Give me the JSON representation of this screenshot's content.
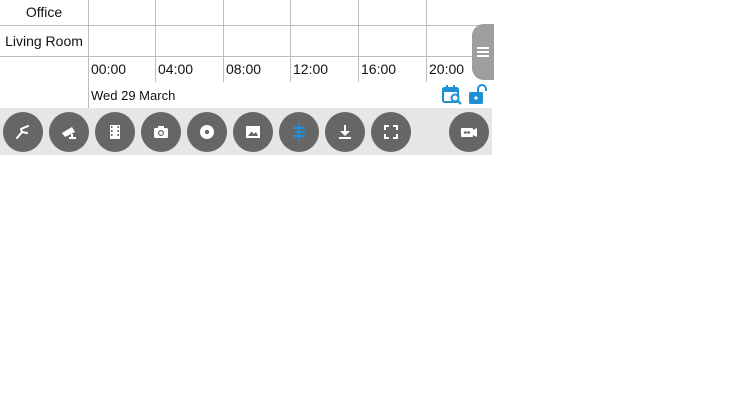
{
  "timeline": {
    "rows": [
      {
        "label": "Office"
      },
      {
        "label": "Living Room"
      }
    ],
    "ticks": [
      "00:00",
      "04:00",
      "08:00",
      "12:00",
      "16:00",
      "20:00"
    ],
    "date": "Wed 29 March"
  },
  "toolbar": {
    "buttons": [
      {
        "icon": "motion-icon"
      },
      {
        "icon": "camera-ptz-icon"
      },
      {
        "icon": "film-icon"
      },
      {
        "icon": "snapshot-icon"
      },
      {
        "icon": "record-icon"
      },
      {
        "icon": "image-icon"
      },
      {
        "icon": "timeline-icon",
        "active": true
      },
      {
        "icon": "download-icon"
      },
      {
        "icon": "fullscreen-icon"
      },
      {
        "icon": "switch-camera-icon"
      }
    ]
  },
  "colors": {
    "accent": "#1e90d6",
    "button_bg": "#666666",
    "toolbar_bg": "#e6e6e6",
    "grid": "#bdbdbd"
  }
}
